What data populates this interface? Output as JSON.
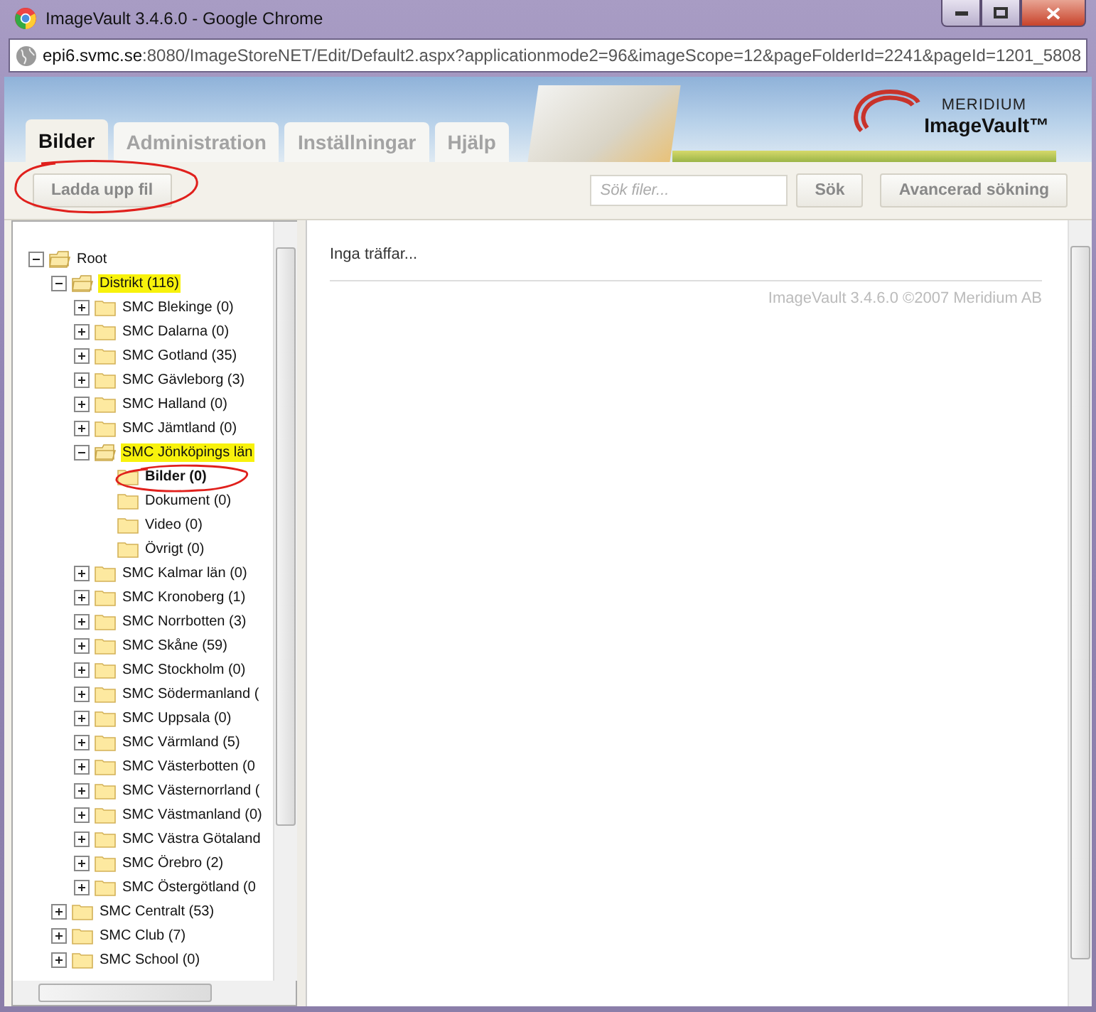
{
  "window": {
    "title": "ImageVault 3.4.6.0 - Google Chrome",
    "address_host": "epi6.svmc.se",
    "address_rest": ":8080/ImageStoreNET/Edit/Default2.aspx?applicationmode2=96&imageScope=12&pageFolderId=2241&pageId=1201_5808"
  },
  "logo": {
    "brand": "MERIDIUM",
    "product": "ImageVault™"
  },
  "tabs": [
    {
      "label": "Bilder",
      "selected": true
    },
    {
      "label": "Administration",
      "selected": false
    },
    {
      "label": "Inställningar",
      "selected": false
    },
    {
      "label": "Hjälp",
      "selected": false
    }
  ],
  "toolbar": {
    "upload_button": {
      "label": "Ladda upp fil",
      "circled": true
    },
    "search": {
      "placeholder": "Sök filer..."
    },
    "search_button": "Sök",
    "advanced_button": "Avancerad sökning"
  },
  "tree": [
    {
      "label": "Root",
      "kind": "branch",
      "expanded": true,
      "selected": false,
      "highlighted": false,
      "circled": false,
      "children": [
        {
          "label": "Distrikt (116)",
          "kind": "branch",
          "expanded": true,
          "selected": false,
          "highlighted": true,
          "circled": false,
          "children": [
            {
              "label": "SMC Blekinge (0)",
              "kind": "branch",
              "expanded": false,
              "selected": false,
              "highlighted": false,
              "circled": false
            },
            {
              "label": "SMC Dalarna (0)",
              "kind": "branch",
              "expanded": false,
              "selected": false,
              "highlighted": false,
              "circled": false
            },
            {
              "label": "SMC Gotland (35)",
              "kind": "branch",
              "expanded": false,
              "selected": false,
              "highlighted": false,
              "circled": false
            },
            {
              "label": "SMC Gävleborg (3)",
              "kind": "branch",
              "expanded": false,
              "selected": false,
              "highlighted": false,
              "circled": false
            },
            {
              "label": "SMC Halland (0)",
              "kind": "branch",
              "expanded": false,
              "selected": false,
              "highlighted": false,
              "circled": false
            },
            {
              "label": "SMC Jämtland (0)",
              "kind": "branch",
              "expanded": false,
              "selected": false,
              "highlighted": false,
              "circled": false
            },
            {
              "label": "SMC Jönköpings län",
              "kind": "branch",
              "expanded": true,
              "selected": false,
              "highlighted": true,
              "circled": false,
              "children": [
                {
                  "label": "Bilder (0)",
                  "kind": "leaf",
                  "selected": true,
                  "highlighted": false,
                  "circled": true
                },
                {
                  "label": "Dokument (0)",
                  "kind": "leaf",
                  "selected": false,
                  "highlighted": false,
                  "circled": false
                },
                {
                  "label": "Video (0)",
                  "kind": "leaf",
                  "selected": false,
                  "highlighted": false,
                  "circled": false
                },
                {
                  "label": "Övrigt (0)",
                  "kind": "leaf",
                  "selected": false,
                  "highlighted": false,
                  "circled": false
                }
              ]
            },
            {
              "label": "SMC Kalmar län (0)",
              "kind": "branch",
              "expanded": false,
              "selected": false,
              "highlighted": false,
              "circled": false
            },
            {
              "label": "SMC Kronoberg (1)",
              "kind": "branch",
              "expanded": false,
              "selected": false,
              "highlighted": false,
              "circled": false
            },
            {
              "label": "SMC Norrbotten (3)",
              "kind": "branch",
              "expanded": false,
              "selected": false,
              "highlighted": false,
              "circled": false
            },
            {
              "label": "SMC Skåne (59)",
              "kind": "branch",
              "expanded": false,
              "selected": false,
              "highlighted": false,
              "circled": false
            },
            {
              "label": "SMC Stockholm (0)",
              "kind": "branch",
              "expanded": false,
              "selected": false,
              "highlighted": false,
              "circled": false
            },
            {
              "label": "SMC Södermanland (",
              "kind": "branch",
              "expanded": false,
              "selected": false,
              "highlighted": false,
              "circled": false
            },
            {
              "label": "SMC Uppsala (0)",
              "kind": "branch",
              "expanded": false,
              "selected": false,
              "highlighted": false,
              "circled": false
            },
            {
              "label": "SMC Värmland (5)",
              "kind": "branch",
              "expanded": false,
              "selected": false,
              "highlighted": false,
              "circled": false
            },
            {
              "label": "SMC Västerbotten (0",
              "kind": "branch",
              "expanded": false,
              "selected": false,
              "highlighted": false,
              "circled": false
            },
            {
              "label": "SMC Västernorrland (",
              "kind": "branch",
              "expanded": false,
              "selected": false,
              "highlighted": false,
              "circled": false
            },
            {
              "label": "SMC Västmanland (0)",
              "kind": "branch",
              "expanded": false,
              "selected": false,
              "highlighted": false,
              "circled": false
            },
            {
              "label": "SMC Västra Götaland",
              "kind": "branch",
              "expanded": false,
              "selected": false,
              "highlighted": false,
              "circled": false
            },
            {
              "label": "SMC Örebro (2)",
              "kind": "branch",
              "expanded": false,
              "selected": false,
              "highlighted": false,
              "circled": false
            },
            {
              "label": "SMC Östergötland (0",
              "kind": "branch",
              "expanded": false,
              "selected": false,
              "highlighted": false,
              "circled": false
            }
          ]
        },
        {
          "label": "SMC Centralt (53)",
          "kind": "branch",
          "expanded": false,
          "selected": false,
          "highlighted": false,
          "circled": false
        },
        {
          "label": "SMC Club (7)",
          "kind": "branch",
          "expanded": false,
          "selected": false,
          "highlighted": false,
          "circled": false
        },
        {
          "label": "SMC School (0)",
          "kind": "branch",
          "expanded": false,
          "selected": false,
          "highlighted": false,
          "circled": false
        }
      ]
    }
  ],
  "results": {
    "message": "Inga träffar...",
    "footer": "ImageVault 3.4.6.0 ©2007 Meridium AB"
  }
}
